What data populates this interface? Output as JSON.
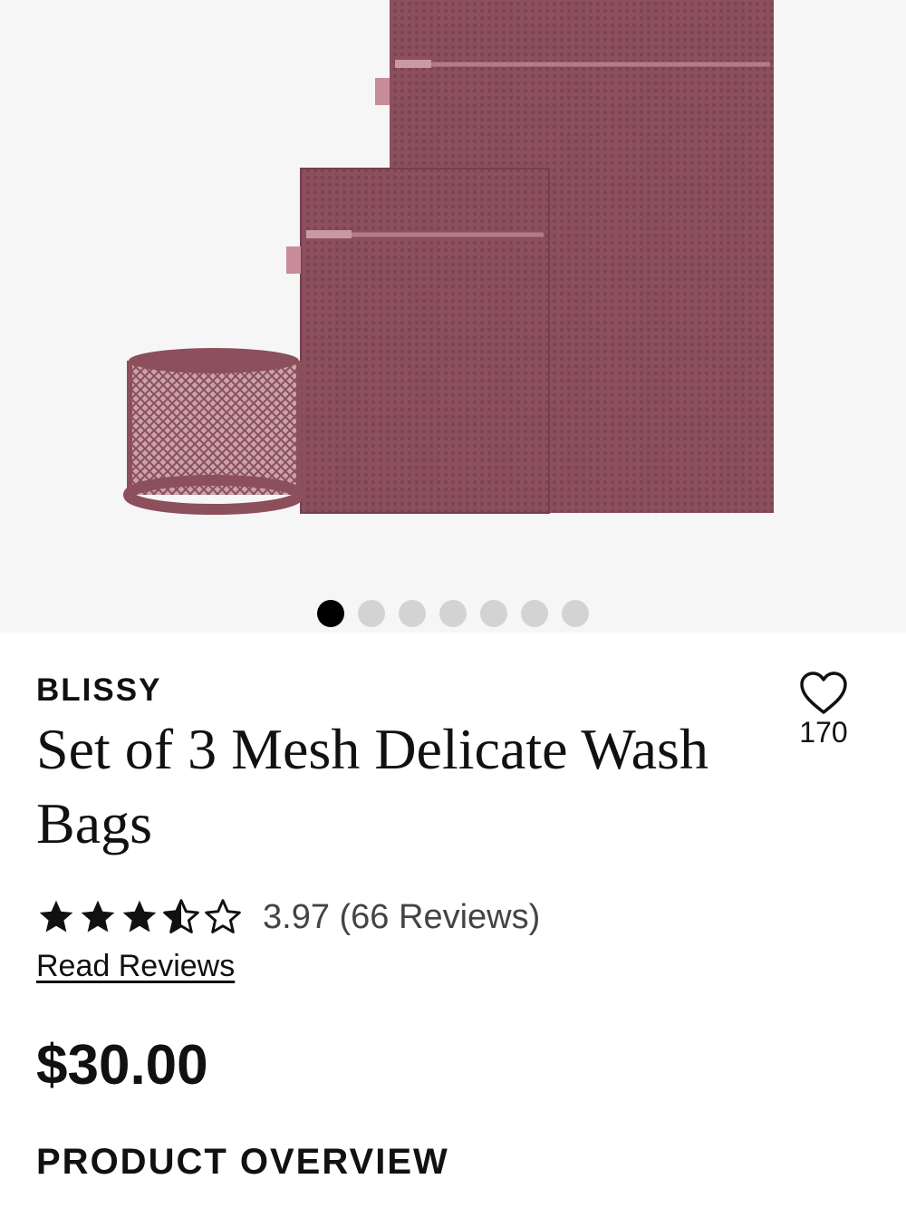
{
  "gallery": {
    "image_alt": "Set of 3 mesh wash bags in mauve",
    "image_count": 7,
    "active_index": 0,
    "bag_color": "#8c4f5c"
  },
  "product": {
    "brand": "BLISSY",
    "title": "Set of 3 Mesh Delicate Wash Bags",
    "favorites_count": "170",
    "rating_value": 3.97,
    "rating_max": 5,
    "rating_text": "3.97 (66 Reviews)",
    "read_reviews_label": "Read Reviews",
    "price": "$30.00",
    "section_heading": "PRODUCT OVERVIEW"
  },
  "icons": {
    "favorite": "heart-outline-icon",
    "star_full": "star-filled-icon",
    "star_half": "star-half-icon",
    "star_empty": "star-outline-icon"
  }
}
